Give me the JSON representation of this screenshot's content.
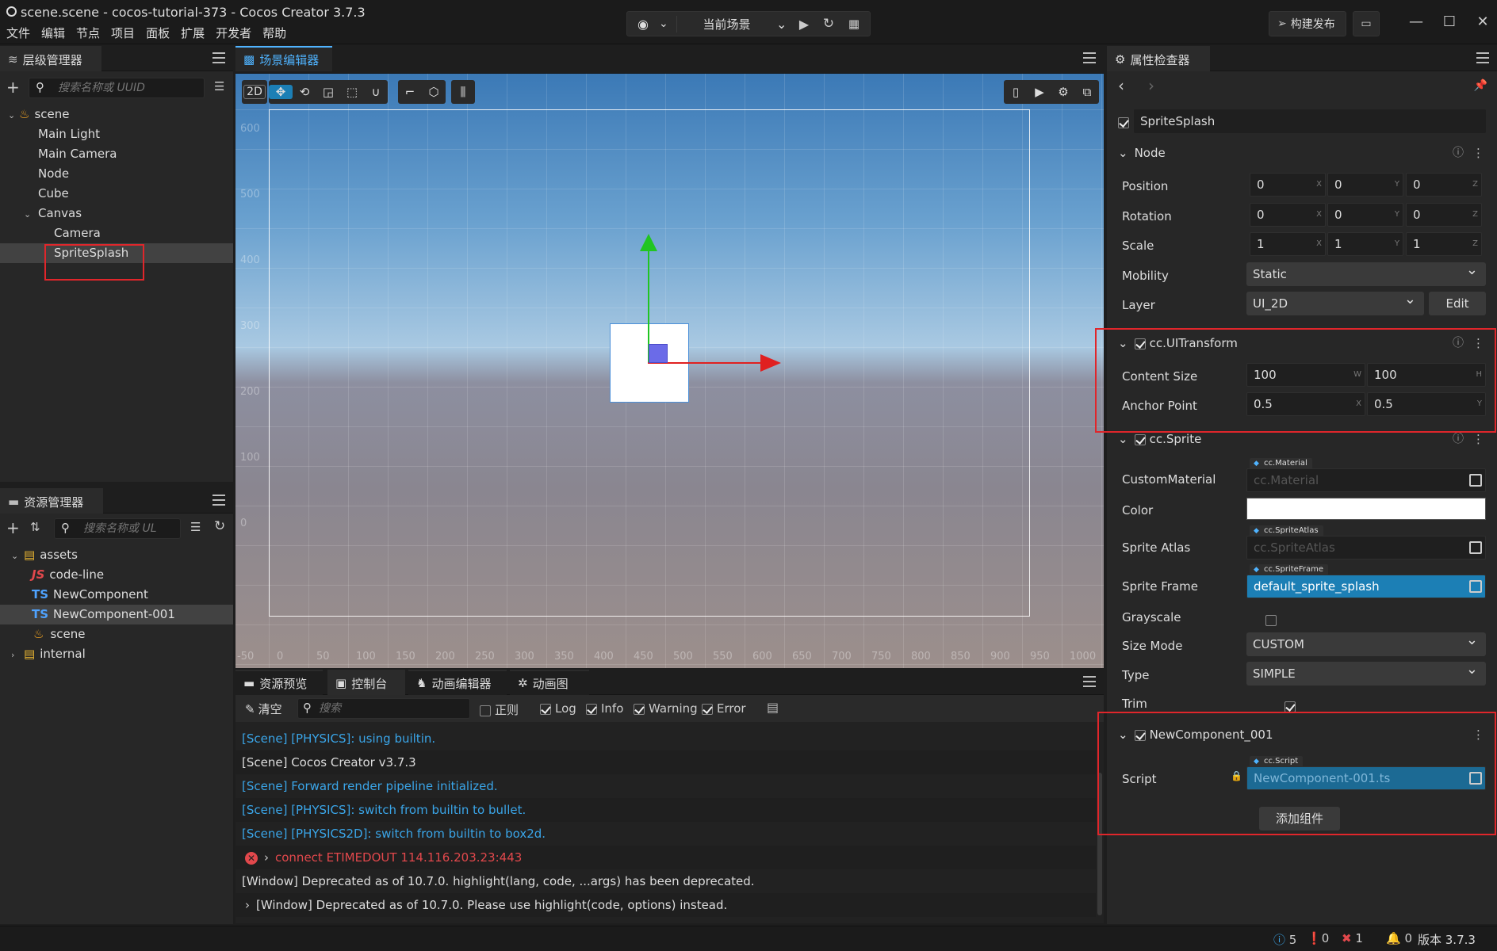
{
  "window": {
    "title": "scene.scene - cocos-tutorial-373 - Cocos Creator 3.7.3",
    "menu": [
      "文件",
      "编辑",
      "节点",
      "项目",
      "面板",
      "扩展",
      "开发者",
      "帮助"
    ],
    "scene_select": "当前场景",
    "build_button": "构建发布"
  },
  "hierarchy": {
    "tab": "层级管理器",
    "search_placeholder": "搜索名称或 UUID",
    "items": [
      {
        "label": "scene"
      },
      {
        "label": "Main Light"
      },
      {
        "label": "Main Camera"
      },
      {
        "label": "Node"
      },
      {
        "label": "Cube"
      },
      {
        "label": "Canvas"
      },
      {
        "label": "Camera"
      },
      {
        "label": "SpriteSplash"
      }
    ]
  },
  "assets": {
    "tab": "资源管理器",
    "search_placeholder": "搜索名称或 UL",
    "items": [
      {
        "label": "assets",
        "icon": "JS"
      },
      {
        "label": "code-line",
        "badge": "JS"
      },
      {
        "label": "NewComponent",
        "badge": "TS"
      },
      {
        "label": "NewComponent-001",
        "badge": "TS"
      },
      {
        "label": "scene"
      },
      {
        "label": "internal"
      }
    ]
  },
  "scene_editor": {
    "tab": "场景编辑器",
    "mode_2d": "2D",
    "y_ticks": [
      "600",
      "500",
      "400",
      "300",
      "200",
      "100",
      "0"
    ],
    "x_ticks": [
      "-50",
      "0",
      "50",
      "100",
      "150",
      "200",
      "250",
      "300",
      "350",
      "400",
      "450",
      "500",
      "550",
      "600",
      "650",
      "700",
      "750",
      "800",
      "850",
      "900",
      "950",
      "1000"
    ]
  },
  "bottom_tabs": [
    "资源预览",
    "控制台",
    "动画编辑器",
    "动画图"
  ],
  "console": {
    "clear": "清空",
    "search_placeholder": "搜索",
    "filters": {
      "regex": "正则",
      "log": "Log",
      "info": "Info",
      "warning": "Warning",
      "error": "Error"
    },
    "lines": [
      "[Scene] [PHYSICS]: using builtin.",
      "[Scene] Cocos Creator v3.7.3",
      "[Scene] Forward render pipeline initialized.",
      "[Scene] [PHYSICS]: switch from builtin to bullet.",
      "[Scene] [PHYSICS2D]: switch from builtin to box2d.",
      "connect ETIMEDOUT 114.116.203.23:443",
      "[Window] Deprecated as of 10.7.0. highlight(lang, code, ...args) has been deprecated.",
      "[Window] Deprecated as of 10.7.0. Please use highlight(code, options) instead."
    ]
  },
  "inspector": {
    "tab": "属性检查器",
    "node_name": "SpriteSplash",
    "node_section": "Node",
    "position": {
      "label": "Position",
      "x": "0",
      "y": "0",
      "z": "0"
    },
    "rotation": {
      "label": "Rotation",
      "x": "0",
      "y": "0",
      "z": "0"
    },
    "scale": {
      "label": "Scale",
      "x": "1",
      "y": "1",
      "z": "1"
    },
    "mobility": {
      "label": "Mobility",
      "value": "Static"
    },
    "layer": {
      "label": "Layer",
      "value": "UI_2D",
      "edit": "Edit"
    },
    "ui_transform": {
      "title": "cc.UITransform",
      "content_size": {
        "label": "Content Size",
        "w": "100",
        "h": "100"
      },
      "anchor_point": {
        "label": "Anchor Point",
        "x": "0.5",
        "y": "0.5"
      }
    },
    "sprite": {
      "title": "cc.Sprite",
      "custom_material": {
        "label": "CustomMaterial",
        "tag": "cc.Material",
        "value": "cc.Material"
      },
      "color": {
        "label": "Color",
        "value": "#ffffff"
      },
      "sprite_atlas": {
        "label": "Sprite Atlas",
        "tag": "cc.SpriteAtlas",
        "value": "cc.SpriteAtlas"
      },
      "sprite_frame": {
        "label": "Sprite Frame",
        "tag": "cc.SpriteFrame",
        "value": "default_sprite_splash"
      },
      "grayscale": {
        "label": "Grayscale"
      },
      "size_mode": {
        "label": "Size Mode",
        "value": "CUSTOM"
      },
      "type": {
        "label": "Type",
        "value": "SIMPLE"
      },
      "trim": {
        "label": "Trim"
      }
    },
    "new_component": {
      "title": "NewComponent_001",
      "script": {
        "label": "Script",
        "tag": "cc.Script",
        "value": "NewComponent-001.ts"
      }
    },
    "add_component": "添加组件"
  },
  "status_bar": {
    "info_count": "5",
    "warn_count": "0",
    "error_count": "1",
    "notify_count": "0",
    "version": "版本 3.7.3"
  },
  "colors": {
    "accent": "#4fb3ff",
    "highlight_box": "#e0262b",
    "link_blue": "#3aa5e8",
    "error_red": "#e2484c",
    "selected_field": "#1c7fb5"
  }
}
